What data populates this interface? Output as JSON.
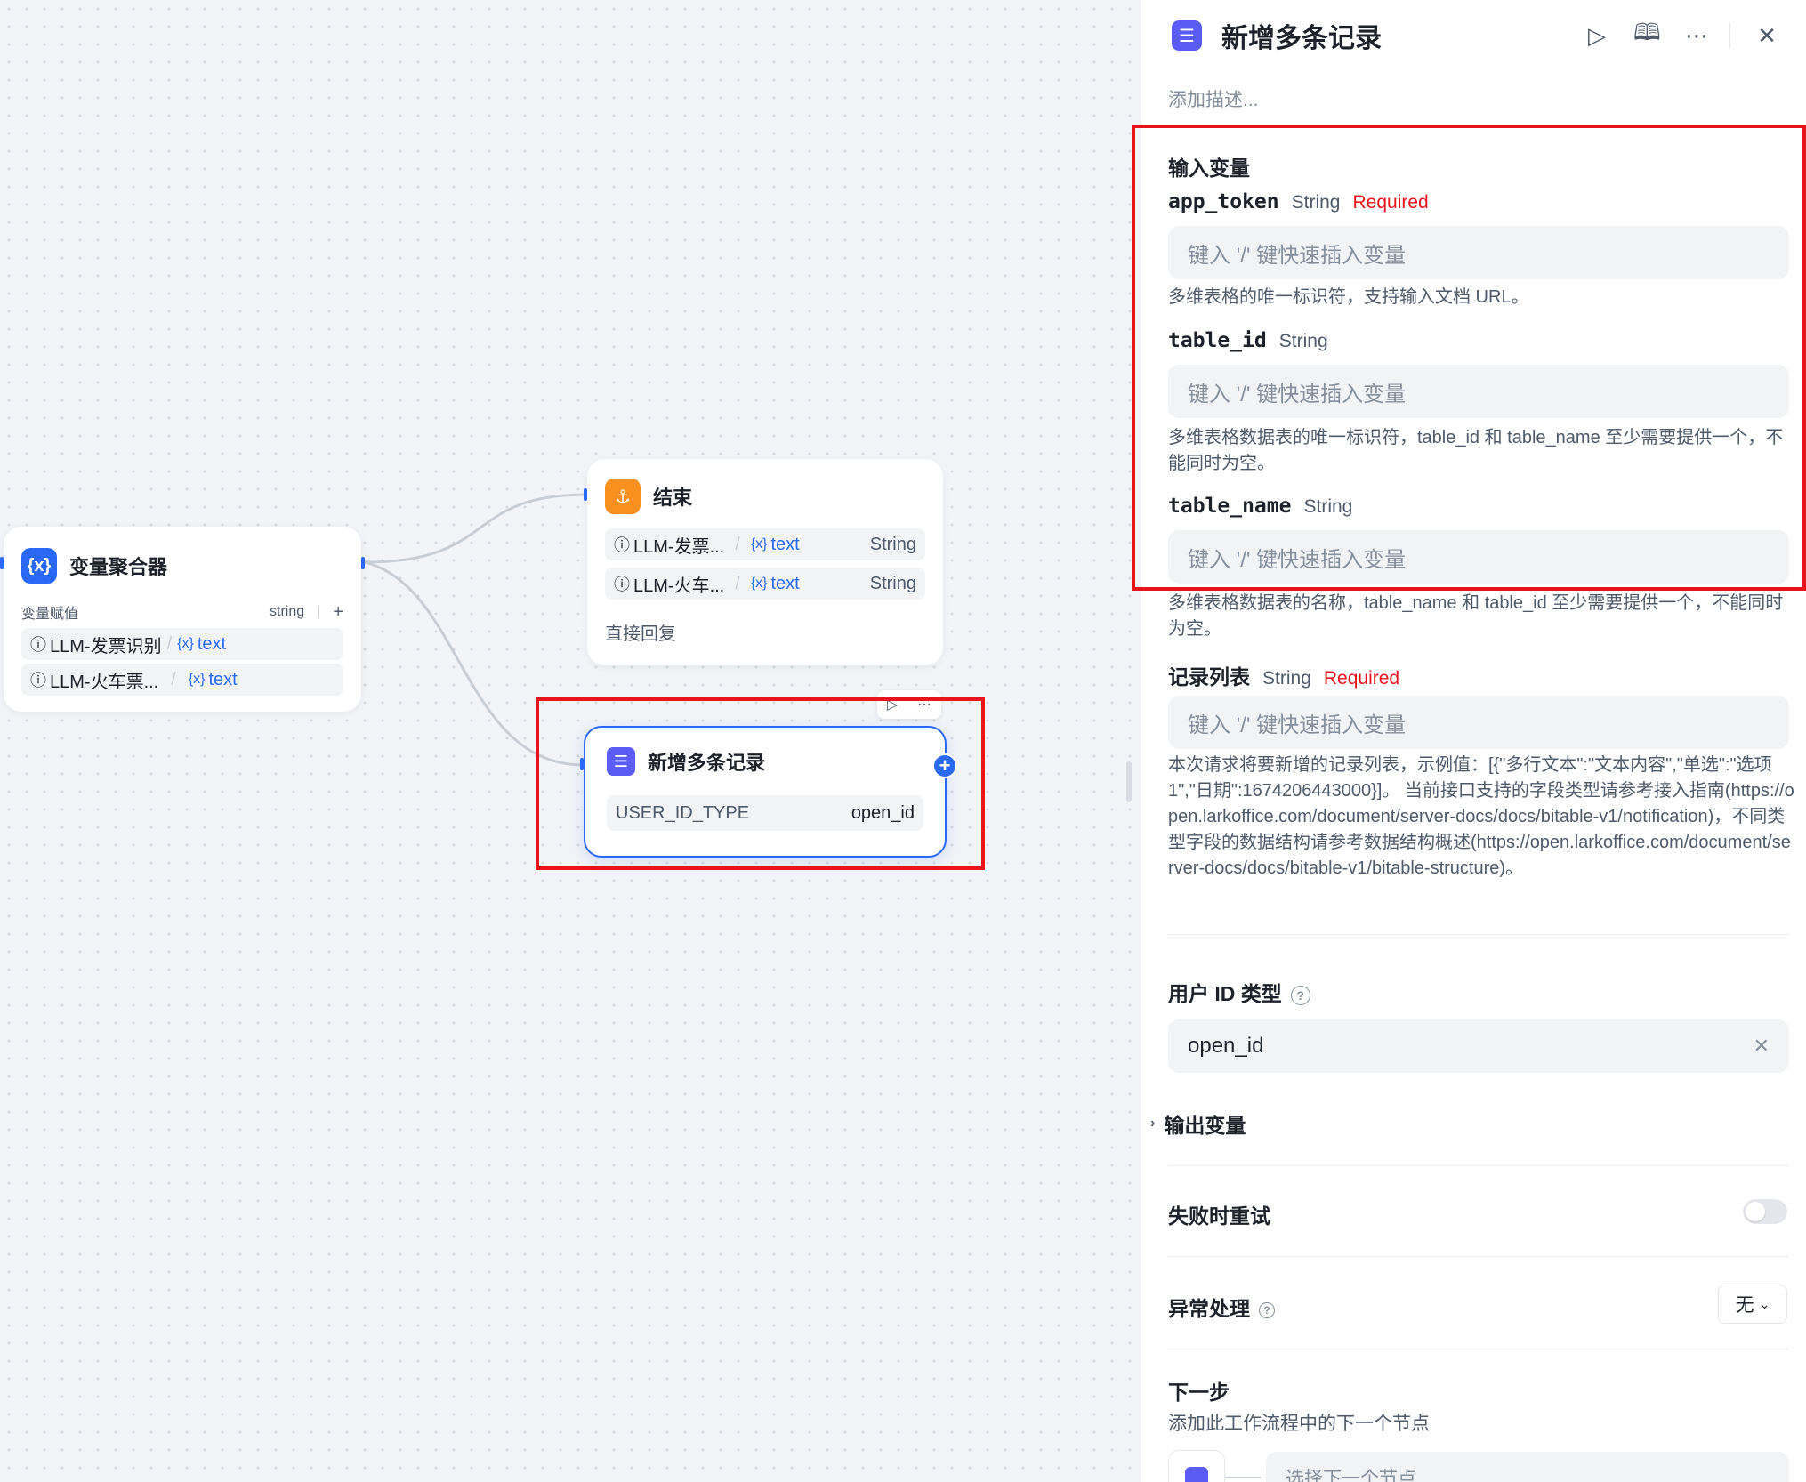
{
  "canvas": {
    "aggregator": {
      "title": "变量聚合器",
      "icon": "variable-brace-icon",
      "sub_label": "变量赋值",
      "sub_type": "string",
      "add": "+",
      "rows": [
        {
          "source": "LLM-发票识别",
          "var_icon": "{x}",
          "var": "text"
        },
        {
          "source": "LLM-火车票...",
          "var_icon": "{x}",
          "var": "text"
        }
      ]
    },
    "end_node": {
      "title": "结束",
      "rows": [
        {
          "source": "LLM-发票...",
          "var_icon": "{x}",
          "var": "text",
          "type": "String"
        },
        {
          "source": "LLM-火车...",
          "var_icon": "{x}",
          "var": "text",
          "type": "String"
        }
      ],
      "reply": "直接回复"
    },
    "active_node": {
      "title": "新增多条记录",
      "param_name": "USER_ID_TYPE",
      "param_value": "open_id"
    },
    "colors": {
      "accent": "#2b68f5",
      "highlight": "#e8141c",
      "end_icon": "#f7901e",
      "doc_icon": "#5b5cf5"
    }
  },
  "panel": {
    "title": "新增多条记录",
    "description_placeholder": "添加描述...",
    "input_section_title": "输入变量",
    "params": [
      {
        "name": "app_token",
        "type": "String",
        "required": "Required",
        "placeholder": "键入 '/' 键快速插入变量",
        "help": "多维表格的唯一标识符，支持输入文档 URL。"
      },
      {
        "name": "table_id",
        "type": "String",
        "required": "",
        "placeholder": "键入 '/' 键快速插入变量",
        "help": "多维表格数据表的唯一标识符，table_id 和 table_name 至少需要提供一个，不能同时为空。"
      },
      {
        "name": "table_name",
        "type": "String",
        "required": "",
        "placeholder": "键入 '/' 键快速插入变量",
        "help": "多维表格数据表的名称，table_name 和 table_id 至少需要提供一个，不能同时为空。"
      },
      {
        "name": "记录列表",
        "type": "String",
        "required": "Required",
        "placeholder": "键入 '/' 键快速插入变量",
        "help": "本次请求将要新增的记录列表，示例值：[{\"多行文本\":\"文本内容\",\"单选\":\"选项 1\",\"日期\":1674206443000}]。 当前接口支持的字段类型请参考接入指南(https://open.larkoffice.com/document/server-docs/docs/bitable-v1/notification)，不同类型字段的数据结构请参考数据结构概述(https://open.larkoffice.com/document/server-docs/docs/bitable-v1/bitable-structure)。"
      }
    ],
    "user_id_type": {
      "label": "用户 ID 类型",
      "value": "open_id"
    },
    "output_section_title": "输出变量",
    "retry_label": "失败时重试",
    "retry_enabled": false,
    "error_label": "异常处理",
    "error_value": "无",
    "next_step": {
      "title": "下一步",
      "desc": "添加此工作流程中的下一个节点",
      "select_placeholder": "选择下一个节点"
    }
  }
}
